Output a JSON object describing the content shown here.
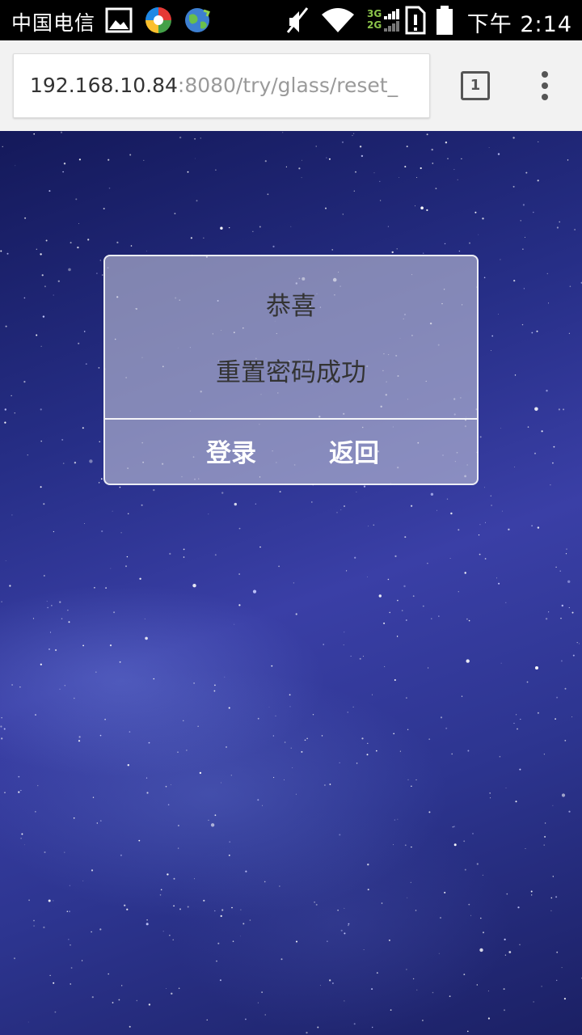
{
  "status_bar": {
    "carrier": "中国电信",
    "time": "下午 2:14",
    "network_3g": "3G",
    "network_2g": "2G",
    "icons": [
      "gallery-icon",
      "app-icon",
      "globe-icon",
      "mute-icon",
      "wifi-icon",
      "signal-icon",
      "sim-alert-icon",
      "battery-icon"
    ]
  },
  "browser": {
    "url_host": "192.168.10.84",
    "url_path": ":8080/try/glass/reset_",
    "tab_count": "1"
  },
  "dialog": {
    "title": "恭喜",
    "message": "重置密码成功",
    "buttons": [
      "登录",
      "返回"
    ]
  }
}
